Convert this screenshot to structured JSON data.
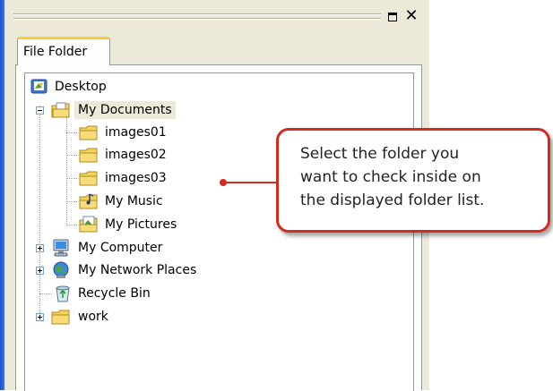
{
  "panel": {
    "tab_label": "File Folder",
    "controls": {
      "restore_icon": "restore-window-icon",
      "close_icon": "close-icon",
      "close_glyph": "✕"
    }
  },
  "tree": {
    "items": [
      {
        "label": "Desktop",
        "icon": "desktop-icon",
        "expander": "none"
      },
      {
        "label": "My Documents",
        "icon": "documents-folder-icon",
        "expander": "minus",
        "selected": true
      },
      {
        "label": "images01",
        "icon": "folder-icon",
        "expander": "none"
      },
      {
        "label": "images02",
        "icon": "folder-icon",
        "expander": "none"
      },
      {
        "label": "images03",
        "icon": "folder-icon",
        "expander": "none"
      },
      {
        "label": "My Music",
        "icon": "music-folder-icon",
        "expander": "none"
      },
      {
        "label": "My Pictures",
        "icon": "pictures-folder-icon",
        "expander": "none"
      },
      {
        "label": "My Computer",
        "icon": "computer-icon",
        "expander": "plus"
      },
      {
        "label": "My Network Places",
        "icon": "network-places-icon",
        "expander": "plus"
      },
      {
        "label": "Recycle Bin",
        "icon": "recycle-bin-icon",
        "expander": "none"
      },
      {
        "label": "work",
        "icon": "folder-icon",
        "expander": "plus"
      }
    ]
  },
  "callout": {
    "lines": [
      "Select the folder you",
      "want to check inside on",
      "the displayed folder list."
    ]
  },
  "colors": {
    "accent_red": "#d52a20",
    "tab_highlight": "#ffc83c",
    "selection_bg": "#ece9d8",
    "folder_yellow": "#f5d25a"
  }
}
